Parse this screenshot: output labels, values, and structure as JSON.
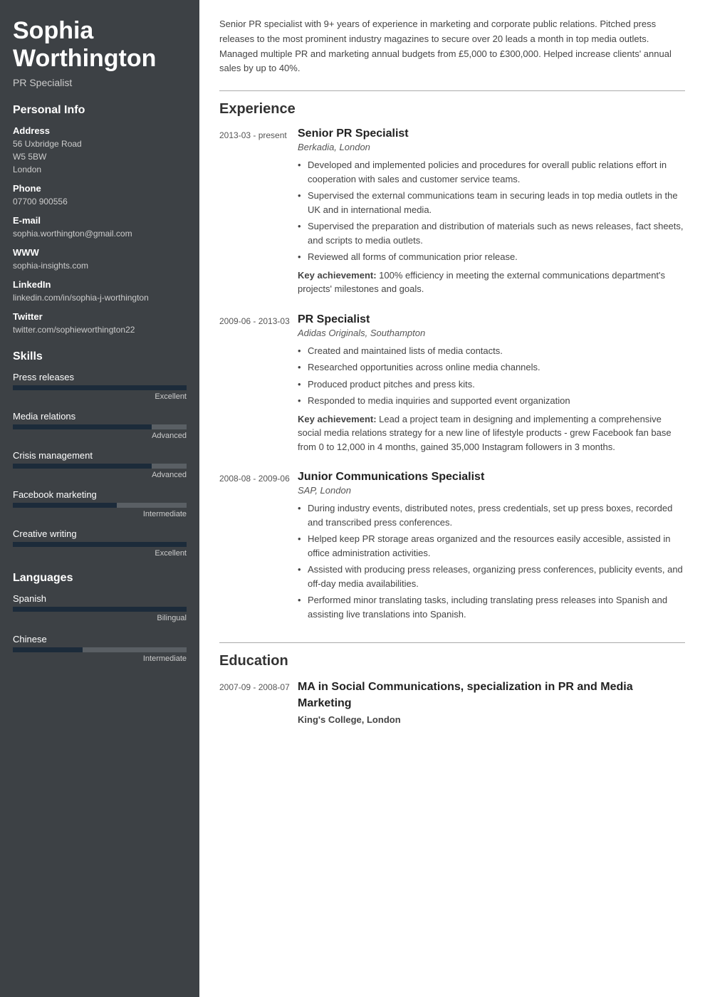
{
  "sidebar": {
    "name": "Sophia Worthington",
    "title": "PR Specialist",
    "personal_info_label": "Personal Info",
    "address_label": "Address",
    "address_lines": [
      "56 Uxbridge Road",
      "W5 5BW",
      "London"
    ],
    "phone_label": "Phone",
    "phone_value": "07700 900556",
    "email_label": "E-mail",
    "email_value": "sophia.worthington@gmail.com",
    "www_label": "WWW",
    "www_value": "sophia-insights.com",
    "linkedin_label": "LinkedIn",
    "linkedin_value": "linkedin.com/in/sophia-j-worthington",
    "twitter_label": "Twitter",
    "twitter_value": "twitter.com/sophieworthington22",
    "skills_label": "Skills",
    "skills": [
      {
        "name": "Press releases",
        "level_label": "Excellent",
        "pct": 100
      },
      {
        "name": "Media relations",
        "level_label": "Advanced",
        "pct": 80
      },
      {
        "name": "Crisis management",
        "level_label": "Advanced",
        "pct": 80
      },
      {
        "name": "Facebook marketing",
        "level_label": "Intermediate",
        "pct": 60
      },
      {
        "name": "Creative writing",
        "level_label": "Excellent",
        "pct": 100
      }
    ],
    "languages_label": "Languages",
    "languages": [
      {
        "name": "Spanish",
        "level_label": "Bilingual",
        "pct": 100
      },
      {
        "name": "Chinese",
        "level_label": "Intermediate",
        "pct": 40
      }
    ]
  },
  "main": {
    "summary": "Senior PR specialist with 9+ years of experience in marketing and corporate public relations. Pitched press releases to the most prominent industry magazines to secure over 20 leads a month in top media outlets. Managed multiple PR and marketing annual budgets from £5,000 to £300,000. Helped increase clients' annual sales by up to 40%.",
    "experience_heading": "Experience",
    "education_heading": "Education",
    "jobs": [
      {
        "date": "2013-03 - present",
        "title": "Senior PR Specialist",
        "company": "Berkadia, London",
        "bullets": [
          "Developed and implemented policies and procedures for overall public relations effort in cooperation with sales and customer service teams.",
          "Supervised the external communications team in securing leads in top media outlets in the UK and in international media.",
          "Supervised the preparation and distribution of materials such as news releases, fact sheets, and scripts to media outlets.",
          "Reviewed all forms of communication prior release."
        ],
        "achievement_prefix": "Key achievement:",
        "achievement": " 100% efficiency in meeting the external communications department's projects' milestones and goals."
      },
      {
        "date": "2009-06 - 2013-03",
        "title": "PR Specialist",
        "company": "Adidas Originals, Southampton",
        "bullets": [
          "Created and maintained lists of media contacts.",
          "Researched opportunities across online media channels.",
          "Produced product pitches and press kits.",
          "Responded to media inquiries and supported event organization"
        ],
        "achievement_prefix": "Key achievement:",
        "achievement": " Lead a project team in designing and implementing a comprehensive social media relations strategy for a new line of lifestyle products - grew Facebook fan base from 0 to 12,000 in 4 months, gained 35,000 Instagram followers in 3 months."
      },
      {
        "date": "2008-08 - 2009-06",
        "title": "Junior Communications Specialist",
        "company": "SAP, London",
        "bullets": [
          "During industry events, distributed notes, press credentials, set up press boxes, recorded and transcribed press conferences.",
          "Helped keep PR storage areas organized and the resources easily accesible, assisted in office administration activities.",
          "Assisted with producing press releases, organizing press conferences, publicity events, and off-day media availabilities.",
          "Performed minor translating tasks, including translating press releases into Spanish and assisting live translations into Spanish."
        ],
        "achievement_prefix": "",
        "achievement": ""
      }
    ],
    "education": [
      {
        "date": "2007-09 - 2008-07",
        "degree": "MA in Social Communications, specialization in PR and Media Marketing",
        "school": "King's College, London"
      }
    ]
  }
}
